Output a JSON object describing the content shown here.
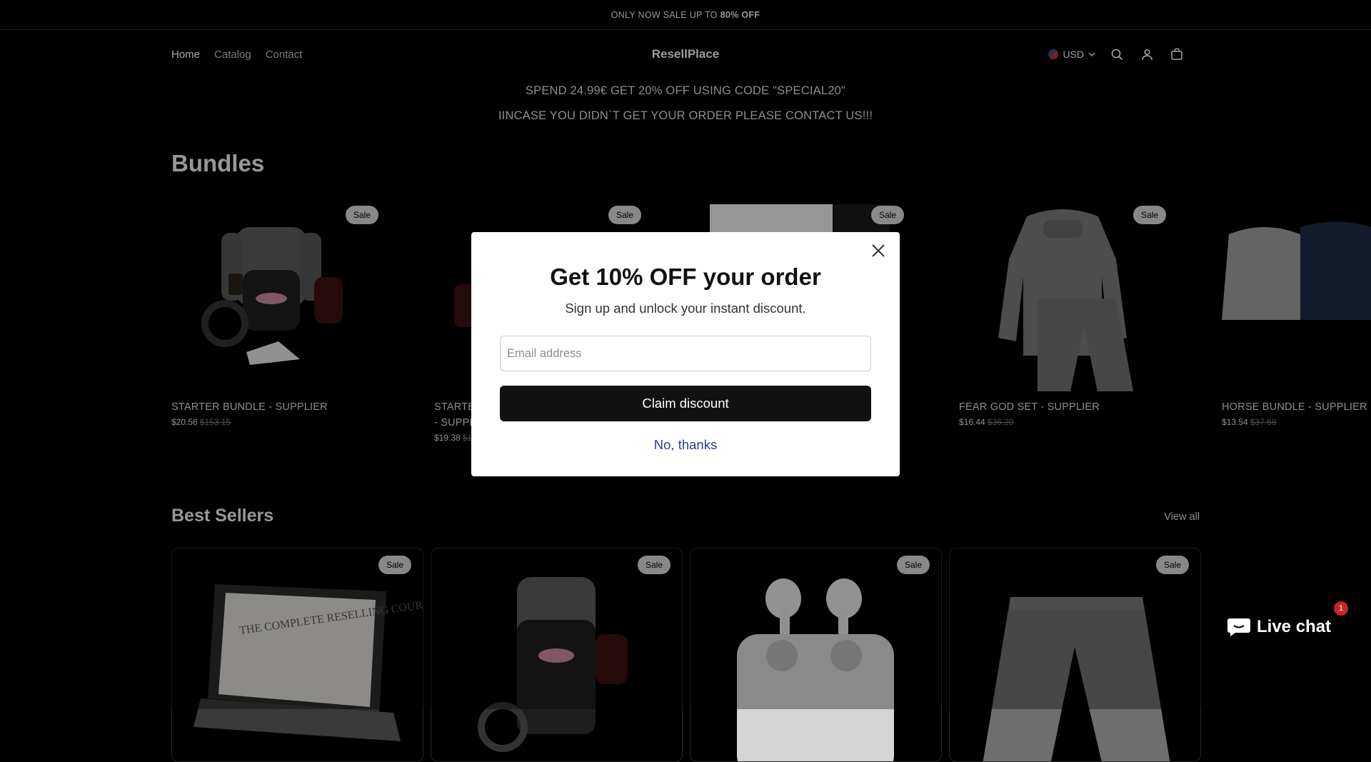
{
  "announcement": {
    "text": "ONLY NOW SALE UP TO",
    "bold": "80% OFF"
  },
  "nav": {
    "items": [
      "Home",
      "Catalog",
      "Contact"
    ]
  },
  "brand": "ResellPlace",
  "currency": "USD",
  "icons": [
    "search-icon",
    "account-icon",
    "cart-icon",
    "close-icon",
    "chat-icon"
  ],
  "promo": {
    "line1": "SPEND 24.99€ GET 20% OFF USING CODE \"SPECIAL20\"",
    "line2": "IINCASE YOU DIDN`T GET YOUR ORDER PLEASE CONTACT US!!!"
  },
  "bundles": {
    "title": "Bundles",
    "items": [
      {
        "name": "STARTER BUNDLE - SUPPLIER",
        "price": "$20.56",
        "old": "$153.15",
        "badge": "Sale"
      },
      {
        "name": "STARTE",
        "name2": "- SUPPL",
        "price": "$19.38",
        "old": "$1",
        "badge": "Sale"
      },
      {
        "name": "",
        "price": "",
        "old": "",
        "badge": "Sale"
      },
      {
        "name": "FEAR GOD SET - SUPPLIER",
        "price": "$16.44",
        "old": "$36.20",
        "badge": "Sale"
      },
      {
        "name": "HORSE BUNDLE - SUPPLIER",
        "price": "$13.54",
        "old": "$37.68",
        "badge": ""
      }
    ]
  },
  "best_sellers": {
    "title": "Best Sellers",
    "view_all": "View all",
    "badges": [
      "Sale",
      "Sale",
      "Sale",
      "Sale"
    ],
    "course_text": "THE COMPLETE RESELLING COURSE"
  },
  "modal": {
    "title": "Get 10% OFF your order",
    "subtitle": "Sign up and unlock your instant discount.",
    "email_placeholder": "Email address",
    "claim_label": "Claim discount",
    "decline_label": "No, thanks"
  },
  "chat": {
    "label": "Live chat",
    "count": "1"
  }
}
